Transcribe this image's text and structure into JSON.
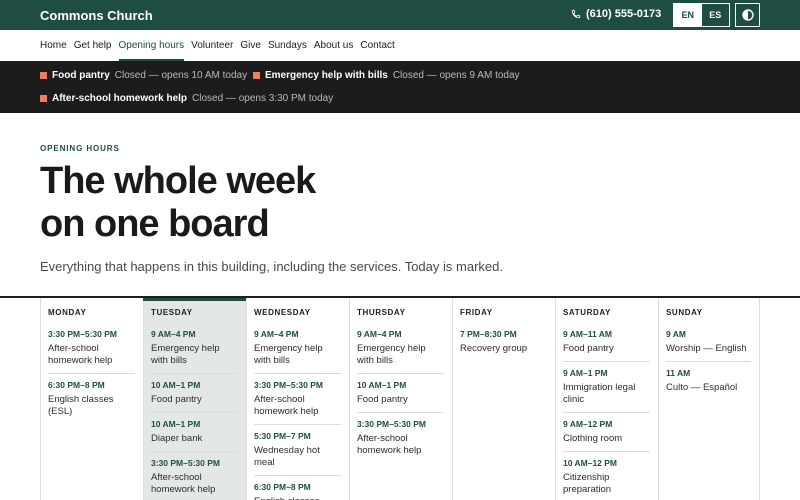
{
  "header": {
    "brand": "Commons Church",
    "phone": "(610) 555-0173",
    "lang_en": "EN",
    "lang_es": "ES"
  },
  "nav": {
    "items": [
      "Home",
      "Get help",
      "Opening hours",
      "Volunteer",
      "Give",
      "Sundays",
      "About us",
      "Contact"
    ],
    "current_index": 2
  },
  "status_bar": {
    "items": [
      {
        "name": "Food pantry",
        "status": "Closed — opens 10 AM today"
      },
      {
        "name": "Emergency help with bills",
        "status": "Closed — opens 9 AM today"
      },
      {
        "name": "After-school homework help",
        "status": "Closed — opens 3:30 PM today"
      }
    ]
  },
  "hero": {
    "eyebrow": "OPENING HOURS",
    "title_line1": "The whole week",
    "title_line2": "on one board",
    "subtitle": "Everything that happens in this building, including the services. Today is marked."
  },
  "week": {
    "today_index": 1,
    "days": [
      {
        "name": "MONDAY",
        "events": [
          {
            "time": "3:30 PM–5:30 PM",
            "name": "After-school homework help"
          },
          {
            "time": "6:30 PM–8 PM",
            "name": "English classes (ESL)"
          }
        ]
      },
      {
        "name": "TUESDAY",
        "events": [
          {
            "time": "9 AM–4 PM",
            "name": "Emergency help with bills"
          },
          {
            "time": "10 AM–1 PM",
            "name": "Food pantry"
          },
          {
            "time": "10 AM–1 PM",
            "name": "Diaper bank"
          },
          {
            "time": "3:30 PM–5:30 PM",
            "name": "After-school homework help"
          }
        ]
      },
      {
        "name": "WEDNESDAY",
        "events": [
          {
            "time": "9 AM–4 PM",
            "name": "Emergency help with bills"
          },
          {
            "time": "3:30 PM–5:30 PM",
            "name": "After-school homework help"
          },
          {
            "time": "5:30 PM–7 PM",
            "name": "Wednesday hot meal"
          },
          {
            "time": "6:30 PM–8 PM",
            "name": "English classes"
          }
        ]
      },
      {
        "name": "THURSDAY",
        "events": [
          {
            "time": "9 AM–4 PM",
            "name": "Emergency help with bills"
          },
          {
            "time": "10 AM–1 PM",
            "name": "Food pantry"
          },
          {
            "time": "3:30 PM–5:30 PM",
            "name": "After-school homework help"
          }
        ]
      },
      {
        "name": "FRIDAY",
        "events": [
          {
            "time": "7 PM–8:30 PM",
            "name": "Recovery group"
          }
        ]
      },
      {
        "name": "SATURDAY",
        "events": [
          {
            "time": "9 AM–11 AM",
            "name": "Food pantry"
          },
          {
            "time": "9 AM–1 PM",
            "name": "Immigration legal clinic"
          },
          {
            "time": "9 AM–12 PM",
            "name": "Clothing room"
          },
          {
            "time": "10 AM–12 PM",
            "name": "Citizenship preparation"
          }
        ]
      },
      {
        "name": "SUNDAY",
        "events": [
          {
            "time": "9 AM",
            "name": "Worship — English"
          },
          {
            "time": "11 AM",
            "name": "Culto — Español"
          }
        ]
      }
    ]
  },
  "icons": {
    "phone": "phone-icon",
    "contrast": "contrast-toggle-icon",
    "status_marker": "status-square-icon"
  },
  "colors": {
    "brand_green": "#1f4d44",
    "status_marker": "#ee8061",
    "status_bar_bg": "#1c1c1c",
    "today_column_bg": "#e4e8e5"
  }
}
